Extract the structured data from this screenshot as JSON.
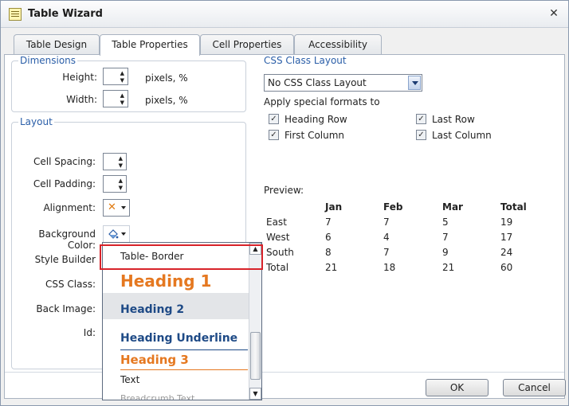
{
  "window": {
    "title": "Table Wizard",
    "close_glyph": "✕"
  },
  "tabs": [
    {
      "label": "Table Design"
    },
    {
      "label": "Table Properties"
    },
    {
      "label": "Cell Properties"
    },
    {
      "label": "Accessibility"
    }
  ],
  "dimensions": {
    "legend": "Dimensions",
    "height_label": "Height:",
    "width_label": "Width:",
    "unit": "pixels, %"
  },
  "layout": {
    "legend": "Layout",
    "cell_spacing": "Cell Spacing:",
    "cell_padding": "Cell Padding:",
    "alignment": "Alignment:",
    "background_color": "Background Color:",
    "style_builder": "Style Builder",
    "css_class": "CSS Class:",
    "back_image": "Back Image:",
    "id": "Id:"
  },
  "css_layout": {
    "legend": "CSS Class Layout",
    "select_value": "No CSS Class Layout",
    "apply_label": "Apply special formats to",
    "checks": [
      {
        "label": "Heading Row",
        "checked": true
      },
      {
        "label": "Last Row",
        "checked": true
      },
      {
        "label": "First Column",
        "checked": true
      },
      {
        "label": "Last Column",
        "checked": true
      }
    ]
  },
  "preview": {
    "label": "Preview:",
    "header": [
      "",
      "Jan",
      "Feb",
      "Mar",
      "Total"
    ],
    "rows": [
      [
        "East",
        "7",
        "7",
        "5",
        "19"
      ],
      [
        "West",
        "6",
        "4",
        "7",
        "17"
      ],
      [
        "South",
        "8",
        "7",
        "9",
        "24"
      ],
      [
        "Total",
        "21",
        "18",
        "21",
        "60"
      ]
    ]
  },
  "dropdown": {
    "items": [
      {
        "label": "Table- Border"
      },
      {
        "label": "Heading 1"
      },
      {
        "label": "Heading 2"
      },
      {
        "label": "Heading Underline"
      },
      {
        "label": "Heading 3"
      },
      {
        "label": "Text"
      },
      {
        "label": "Breadcrumb Text"
      }
    ]
  },
  "buttons": {
    "ok": "OK",
    "cancel": "Cancel"
  },
  "colors": {
    "legend": "#2a5ea8",
    "heading_orange": "#e57820",
    "heading_blue": "#1e4a86",
    "highlight": "#d8232a"
  }
}
